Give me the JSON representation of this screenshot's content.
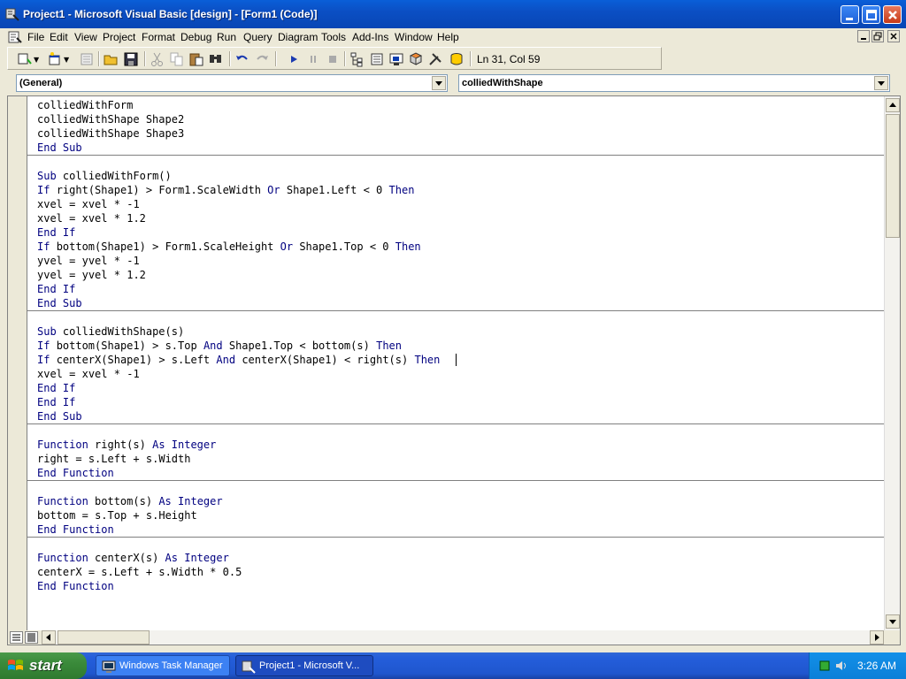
{
  "window": {
    "title": "Project1 - Microsoft Visual Basic [design] - [Form1 (Code)]",
    "caption_buttons": [
      "minimize-icon",
      "maximize-icon",
      "close-icon"
    ]
  },
  "menu": {
    "items": [
      "File",
      "Edit",
      "View",
      "Project",
      "Format",
      "Debug",
      "Run",
      "Query",
      "Diagram",
      "Tools",
      "Add-Ins",
      "Window",
      "Help"
    ]
  },
  "toolbar": {
    "icons": [
      "add-project-icon",
      "add-form-icon",
      "menu-editor-icon",
      "open-icon",
      "save-icon",
      "cut-icon",
      "copy-icon",
      "paste-icon",
      "find-icon",
      "undo-icon",
      "redo-icon",
      "run-icon",
      "break-icon",
      "stop-icon",
      "project-explorer-icon",
      "properties-icon",
      "form-layout-icon",
      "object-browser-icon",
      "toolbox-icon",
      "data-view-icon"
    ],
    "position_label": "Ln 31, Col 59"
  },
  "object_combo": {
    "value": "(General)"
  },
  "procedure_combo": {
    "value": "colliedWithShape"
  },
  "code": {
    "lines": [
      "colliedWithForm",
      "colliedWithShape Shape2",
      "colliedWithShape Shape3",
      "End Sub",
      "",
      "Sub colliedWithForm()",
      "If right(Shape1) > Form1.ScaleWidth Or Shape1.Left < 0 Then",
      "xvel = xvel * -1",
      "xvel = xvel * 1.2",
      "End If",
      "If bottom(Shape1) > Form1.ScaleHeight Or Shape1.Top < 0 Then",
      "yvel = yvel * -1",
      "yvel = yvel * 1.2",
      "End If",
      "End Sub",
      "",
      "Sub colliedWithShape(s)",
      "If bottom(Shape1) > s.Top And Shape1.Top < bottom(s) Then",
      "If centerX(Shape1) > s.Left And centerX(Shape1) < right(s) Then",
      "xvel = xvel * -1",
      "End If",
      "End If",
      "End Sub",
      "",
      "Function right(s) As Integer",
      "right = s.Left + s.Width",
      "End Function",
      "",
      "Function bottom(s) As Integer",
      "bottom = s.Top + s.Height",
      "End Function",
      "",
      "Function centerX(s) As Integer",
      "centerX = s.Left + s.Width * 0.5",
      "End Function"
    ]
  },
  "taskbar": {
    "start_label": "start",
    "tasks": [
      "Windows Task Manager",
      "Project1 - Microsoft V..."
    ],
    "clock": "3:26 AM"
  }
}
